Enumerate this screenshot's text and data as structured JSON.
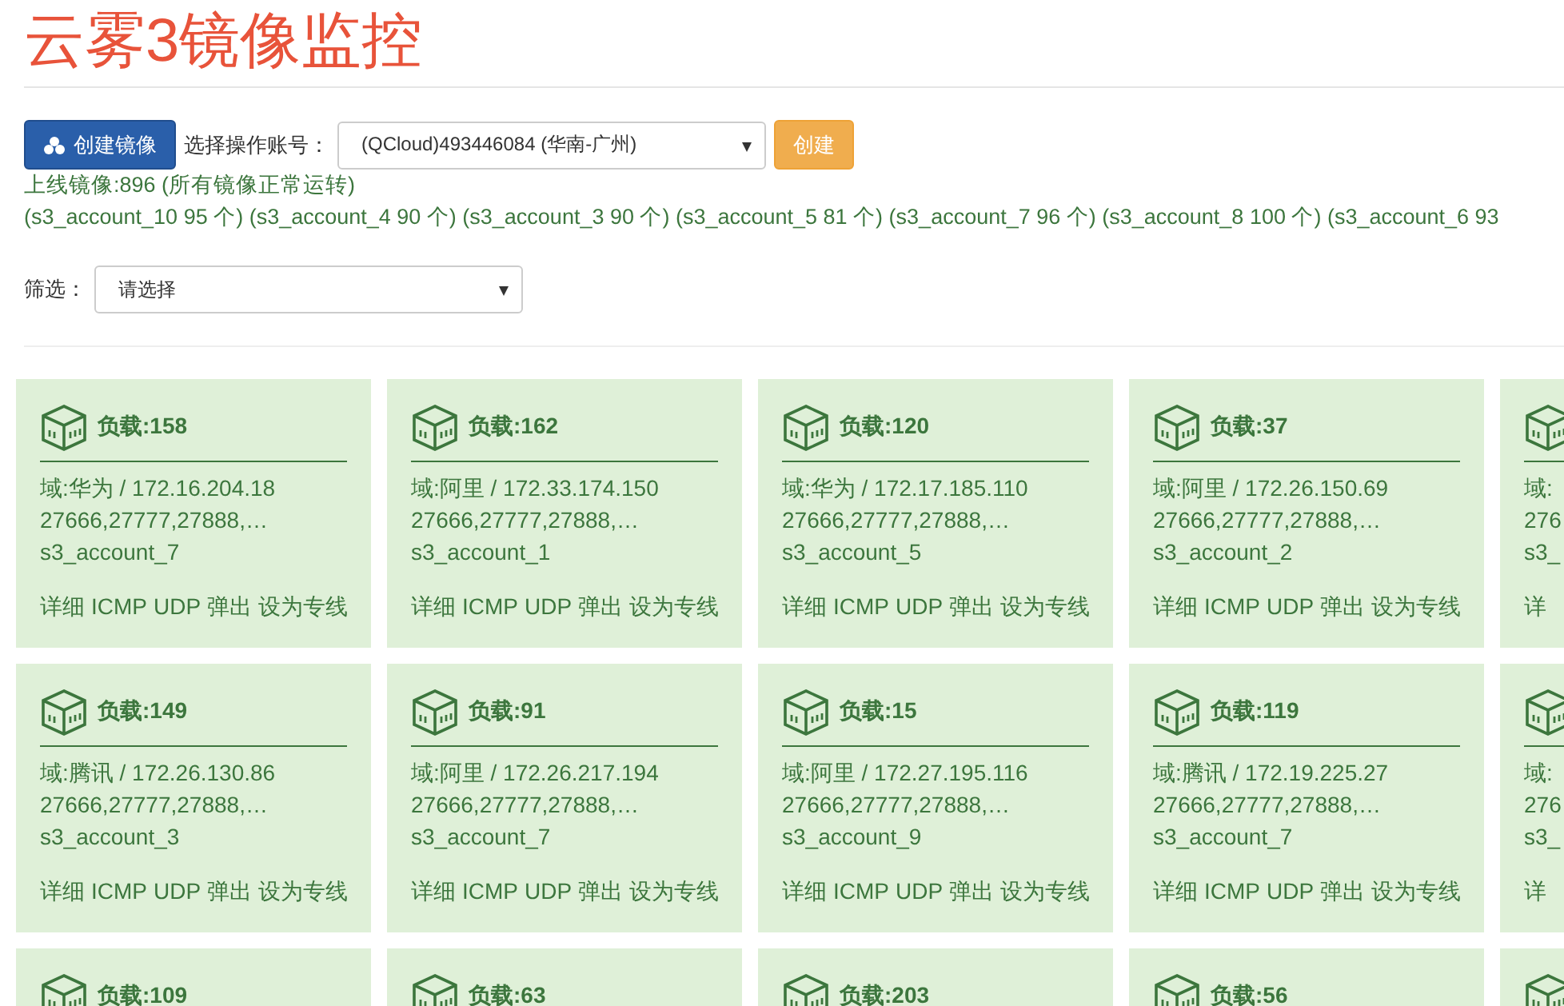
{
  "title": "云雾3镜像监控",
  "toolbar": {
    "create_button": "创建镜像",
    "account_label": "选择操作账号：",
    "account_select": "(QCloud)493446084 (华南-广州)",
    "submit_button": "创建"
  },
  "summary": "上线镜像:896 (所有镜像正常运转)",
  "accounts_line": "(s3_account_10 95 个) (s3_account_4 90 个) (s3_account_3 90 个) (s3_account_5 81 个) (s3_account_7 96 个) (s3_account_8 100 个) (s3_account_6 93",
  "filter": {
    "label": "筛选：",
    "value": "请选择"
  },
  "card_rows": [
    [
      {
        "kind": "full",
        "load": "负载:158",
        "domain": "域:华为 / 172.16.204.18",
        "ports": "27666,27777,27888,…",
        "account": "s3_account_7",
        "actions": [
          "详细",
          "ICMP",
          "UDP",
          "弹出",
          "设为专线"
        ]
      },
      {
        "kind": "full",
        "load": "负载:162",
        "domain": "域:阿里 / 172.33.174.150",
        "ports": "27666,27777,27888,…",
        "account": "s3_account_1",
        "actions": [
          "详细",
          "ICMP",
          "UDP",
          "弹出",
          "设为专线"
        ]
      },
      {
        "kind": "full",
        "load": "负载:120",
        "domain": "域:华为 / 172.17.185.110",
        "ports": "27666,27777,27888,…",
        "account": "s3_account_5",
        "actions": [
          "详细",
          "ICMP",
          "UDP",
          "弹出",
          "设为专线"
        ]
      },
      {
        "kind": "full",
        "load": "负载:37",
        "domain": "域:阿里 / 172.26.150.69",
        "ports": "27666,27777,27888,…",
        "account": "s3_account_2",
        "actions": [
          "详细",
          "ICMP",
          "UDP",
          "弹出",
          "设为专线"
        ]
      },
      {
        "kind": "clipped",
        "domain": "域:",
        "ports": "276",
        "account": "s3_",
        "actions": [
          "详"
        ]
      }
    ],
    [
      {
        "kind": "full",
        "load": "负载:149",
        "domain": "域:腾讯 / 172.26.130.86",
        "ports": "27666,27777,27888,…",
        "account": "s3_account_3",
        "actions": [
          "详细",
          "ICMP",
          "UDP",
          "弹出",
          "设为专线"
        ]
      },
      {
        "kind": "full",
        "load": "负载:91",
        "domain": "域:阿里 / 172.26.217.194",
        "ports": "27666,27777,27888,…",
        "account": "s3_account_7",
        "actions": [
          "详细",
          "ICMP",
          "UDP",
          "弹出",
          "设为专线"
        ]
      },
      {
        "kind": "full",
        "load": "负载:15",
        "domain": "域:阿里 / 172.27.195.116",
        "ports": "27666,27777,27888,…",
        "account": "s3_account_9",
        "actions": [
          "详细",
          "ICMP",
          "UDP",
          "弹出",
          "设为专线"
        ]
      },
      {
        "kind": "full",
        "load": "负载:119",
        "domain": "域:腾讯 / 172.19.225.27",
        "ports": "27666,27777,27888,…",
        "account": "s3_account_7",
        "actions": [
          "详细",
          "ICMP",
          "UDP",
          "弹出",
          "设为专线"
        ]
      },
      {
        "kind": "clipped",
        "domain": "域:",
        "ports": "276",
        "account": "s3_",
        "actions": [
          "详"
        ]
      }
    ],
    [
      {
        "kind": "top",
        "load": "负载:109"
      },
      {
        "kind": "top",
        "load": "负载:63"
      },
      {
        "kind": "top",
        "load": "负载:203"
      },
      {
        "kind": "top",
        "load": "负载:56"
      },
      {
        "kind": "clipped_top"
      }
    ]
  ]
}
